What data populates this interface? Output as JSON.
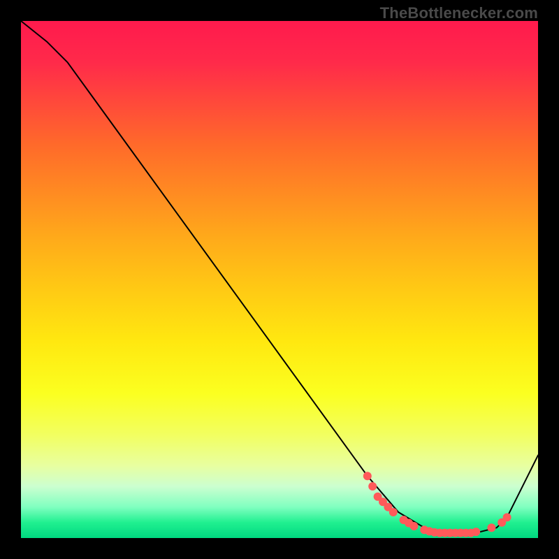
{
  "watermark": "TheBottlenecker.com",
  "chart_data": {
    "type": "line",
    "title": "",
    "xlabel": "",
    "ylabel": "",
    "xlim": [
      0,
      100
    ],
    "ylim": [
      0,
      100
    ],
    "series": [
      {
        "name": "curve",
        "x": [
          0,
          5,
          9,
          67,
          73,
          78,
          83,
          88,
          92,
          94,
          100
        ],
        "y": [
          100,
          96,
          92,
          12,
          5,
          2,
          1,
          1,
          2,
          4,
          16
        ],
        "stroke": "#000000",
        "stroke_width": 2
      },
      {
        "name": "dots",
        "type": "scatter",
        "points": [
          {
            "x": 67,
            "y": 12
          },
          {
            "x": 68,
            "y": 10
          },
          {
            "x": 69,
            "y": 8
          },
          {
            "x": 70,
            "y": 7
          },
          {
            "x": 71,
            "y": 6
          },
          {
            "x": 72,
            "y": 5
          },
          {
            "x": 74,
            "y": 3.5
          },
          {
            "x": 75,
            "y": 2.9
          },
          {
            "x": 76,
            "y": 2.3
          },
          {
            "x": 78,
            "y": 1.6
          },
          {
            "x": 79,
            "y": 1.3
          },
          {
            "x": 80,
            "y": 1.1
          },
          {
            "x": 81,
            "y": 1.0
          },
          {
            "x": 82,
            "y": 1.0
          },
          {
            "x": 83,
            "y": 1.0
          },
          {
            "x": 84,
            "y": 1.0
          },
          {
            "x": 85,
            "y": 1.0
          },
          {
            "x": 86,
            "y": 1.0
          },
          {
            "x": 87,
            "y": 1.0
          },
          {
            "x": 88,
            "y": 1.2
          },
          {
            "x": 91,
            "y": 2.0
          },
          {
            "x": 93,
            "y": 3.0
          },
          {
            "x": 94,
            "y": 4.0
          }
        ],
        "fill": "#ff5a5a",
        "radius": 6
      }
    ],
    "background": {
      "gradient": "vertical",
      "stops": [
        {
          "pos": 0.0,
          "color": "#ff1a4d"
        },
        {
          "pos": 0.5,
          "color": "#ffca14"
        },
        {
          "pos": 0.78,
          "color": "#f2ff60"
        },
        {
          "pos": 1.0,
          "color": "#00d880"
        }
      ]
    }
  }
}
